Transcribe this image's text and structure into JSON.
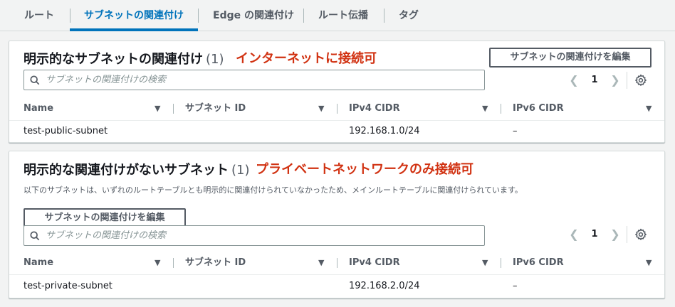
{
  "tabs": [
    {
      "label": "ルート",
      "active": false
    },
    {
      "label": "サブネットの関連付け",
      "active": true
    },
    {
      "label": "Edge の関連付け",
      "active": false
    },
    {
      "label": "ルート伝播",
      "active": false
    },
    {
      "label": "タグ",
      "active": false
    }
  ],
  "explicit_panel": {
    "title": "明示的なサブネットの関連付け",
    "count": "(1)",
    "annotation": "インターネットに接続可",
    "edit_button": "サブネットの関連付けを編集",
    "search_placeholder": "サブネットの関連付けの検索",
    "page": "1",
    "columns": [
      "Name",
      "サブネット ID",
      "IPv4 CIDR",
      "IPv6 CIDR"
    ],
    "rows": [
      {
        "name": "test-public-subnet",
        "subnet_id": "",
        "ipv4": "192.168.1.0/24",
        "ipv6": "–"
      }
    ]
  },
  "implicit_panel": {
    "title": "明示的な関連付けがないサブネット",
    "count": "(1)",
    "annotation": "プライベートネットワークのみ接続可",
    "description": "以下のサブネットは、いずれのルートテーブルとも明示的に関連付けられていなかったため、メインルートテーブルに関連付けられています。",
    "edit_button": "サブネットの関連付けを編集",
    "search_placeholder": "サブネットの関連付けの検索",
    "page": "1",
    "columns": [
      "Name",
      "サブネット ID",
      "IPv4 CIDR",
      "IPv6 CIDR"
    ],
    "rows": [
      {
        "name": "test-private-subnet",
        "subnet_id": "",
        "ipv4": "192.168.2.0/24",
        "ipv6": "–"
      }
    ]
  },
  "icons": {
    "search": "search-icon",
    "settings": "gear-icon",
    "prev": "chevron-left-icon",
    "next": "chevron-right-icon",
    "sort": "caret-down-icon"
  },
  "colors": {
    "accent": "#0073bb",
    "annotation": "#d13212",
    "text": "#16191f",
    "muted": "#545b64"
  }
}
